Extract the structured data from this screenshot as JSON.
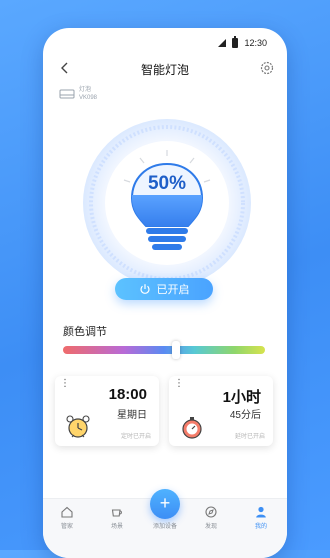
{
  "status_bar": {
    "time": "12:30"
  },
  "header": {
    "title": "智能灯泡"
  },
  "device": {
    "type": "灯泡",
    "model": "VK098"
  },
  "bulb": {
    "brightness_label": "50%",
    "brightness": 0.5
  },
  "power_button": {
    "label": "已开启"
  },
  "color_section": {
    "title": "颜色调节",
    "slider_level": 0.56
  },
  "cards": [
    {
      "time": "18:00",
      "subtitle": "星期日",
      "footer": "定时已开启"
    },
    {
      "time": "1小时",
      "subtitle": "45分后",
      "footer": "延时已开启"
    }
  ],
  "tabbar": {
    "items": [
      {
        "label": "管家",
        "icon": "home-icon"
      },
      {
        "label": "场景",
        "icon": "cup-icon"
      },
      {
        "label": "添加设备",
        "icon": "plus-icon"
      },
      {
        "label": "发现",
        "icon": "compass-icon"
      },
      {
        "label": "我的",
        "icon": "user-icon"
      }
    ]
  },
  "colors": {
    "accent": "#3c8ff4",
    "background": "#4a9bff"
  }
}
